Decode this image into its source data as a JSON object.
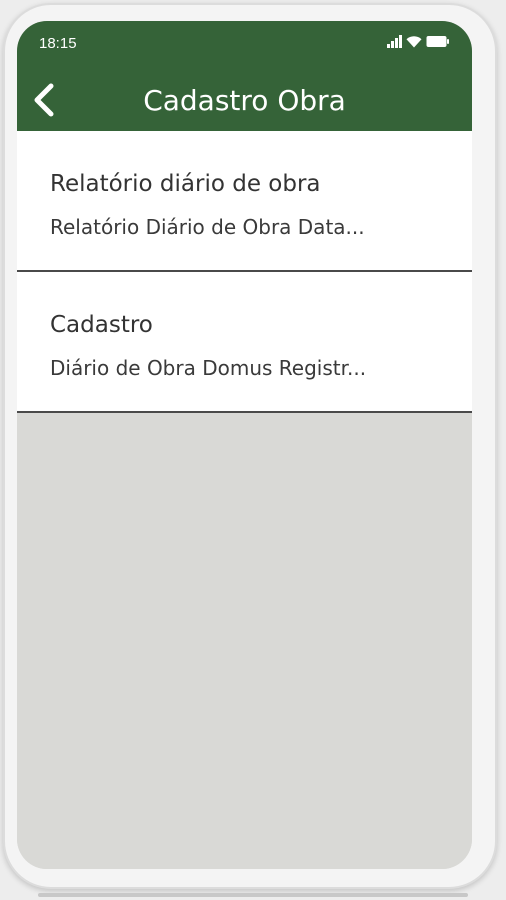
{
  "status_bar": {
    "time": "18:15",
    "icons": [
      "signal-icon",
      "wifi-icon",
      "battery-icon"
    ]
  },
  "header": {
    "title": "Cadastro Obra",
    "back_icon": "chevron-left-icon",
    "background_color": "#356338"
  },
  "list": {
    "items": [
      {
        "title": "Relatório diário de obra",
        "subtitle": "Relatório Diário de Obra Data..."
      },
      {
        "title": "Cadastro",
        "subtitle": "Diário de Obra Domus Registr..."
      }
    ]
  }
}
